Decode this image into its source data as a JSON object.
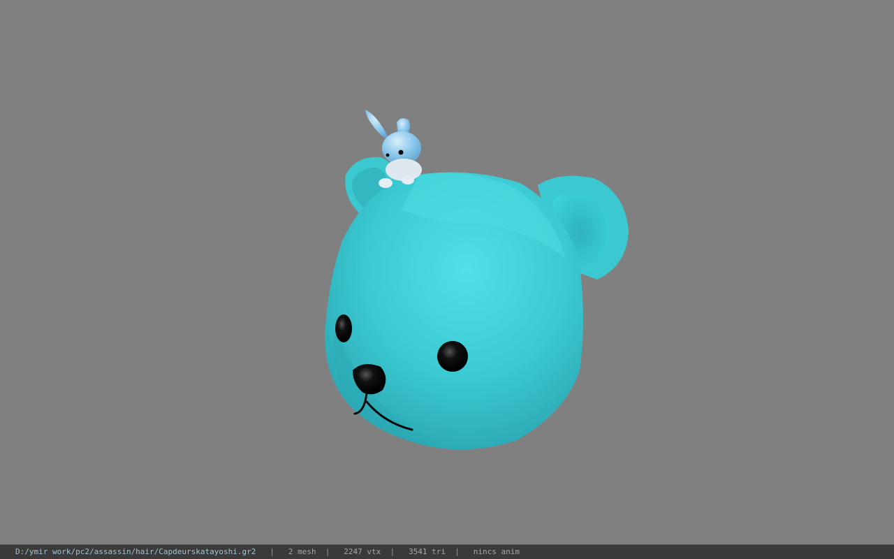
{
  "status_bar": {
    "file_path": "D:/ymir work/pc2/assassin/hair/Capdeurskatayoshi.gr2",
    "separator": "|",
    "mesh_count": "2 mesh",
    "vertex_count": "2247 vtx",
    "triangle_count": "3541 tri",
    "anim_status": "nincs anim"
  },
  "colors": {
    "background": "#808080",
    "bear_body": "#3cc8d0",
    "bear_highlight": "#4fdce4",
    "bear_shadow": "#2aa8b4",
    "bunny_body": "#8cc8ec",
    "eye": "#0a0a0a",
    "status_bar_bg": "#3a3a3a"
  },
  "icons": {
    "model": "bear-head-with-bunny-model"
  }
}
